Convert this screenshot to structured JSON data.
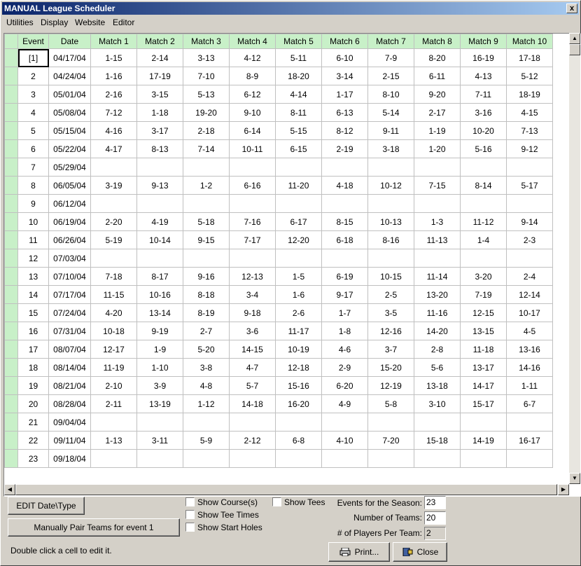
{
  "window": {
    "title": "MANUAL League Scheduler",
    "close_label": "x"
  },
  "menu": [
    "Utilities",
    "Display",
    "Website",
    "Editor"
  ],
  "grid": {
    "headers": [
      "Event",
      "Date",
      "Match 1",
      "Match 2",
      "Match 3",
      "Match 4",
      "Match 5",
      "Match 6",
      "Match 7",
      "Match 8",
      "Match 9",
      "Match 10"
    ],
    "rows": [
      [
        "[1]",
        "04/17/04",
        "1-15",
        "2-14",
        "3-13",
        "4-12",
        "5-11",
        "6-10",
        "7-9",
        "8-20",
        "16-19",
        "17-18"
      ],
      [
        "2",
        "04/24/04",
        "1-16",
        "17-19",
        "7-10",
        "8-9",
        "18-20",
        "3-14",
        "2-15",
        "6-11",
        "4-13",
        "5-12"
      ],
      [
        "3",
        "05/01/04",
        "2-16",
        "3-15",
        "5-13",
        "6-12",
        "4-14",
        "1-17",
        "8-10",
        "9-20",
        "7-11",
        "18-19"
      ],
      [
        "4",
        "05/08/04",
        "7-12",
        "1-18",
        "19-20",
        "9-10",
        "8-11",
        "6-13",
        "5-14",
        "2-17",
        "3-16",
        "4-15"
      ],
      [
        "5",
        "05/15/04",
        "4-16",
        "3-17",
        "2-18",
        "6-14",
        "5-15",
        "8-12",
        "9-11",
        "1-19",
        "10-20",
        "7-13"
      ],
      [
        "6",
        "05/22/04",
        "4-17",
        "8-13",
        "7-14",
        "10-11",
        "6-15",
        "2-19",
        "3-18",
        "1-20",
        "5-16",
        "9-12"
      ],
      [
        "7",
        "05/29/04",
        "",
        "",
        "",
        "",
        "",
        "",
        "",
        "",
        "",
        ""
      ],
      [
        "8",
        "06/05/04",
        "3-19",
        "9-13",
        "1-2",
        "6-16",
        "11-20",
        "4-18",
        "10-12",
        "7-15",
        "8-14",
        "5-17"
      ],
      [
        "9",
        "06/12/04",
        "",
        "",
        "",
        "",
        "",
        "",
        "",
        "",
        "",
        ""
      ],
      [
        "10",
        "06/19/04",
        "2-20",
        "4-19",
        "5-18",
        "7-16",
        "6-17",
        "8-15",
        "10-13",
        "1-3",
        "11-12",
        "9-14"
      ],
      [
        "11",
        "06/26/04",
        "5-19",
        "10-14",
        "9-15",
        "7-17",
        "12-20",
        "6-18",
        "8-16",
        "11-13",
        "1-4",
        "2-3"
      ],
      [
        "12",
        "07/03/04",
        "",
        "",
        "",
        "",
        "",
        "",
        "",
        "",
        "",
        ""
      ],
      [
        "13",
        "07/10/04",
        "7-18",
        "8-17",
        "9-16",
        "12-13",
        "1-5",
        "6-19",
        "10-15",
        "11-14",
        "3-20",
        "2-4"
      ],
      [
        "14",
        "07/17/04",
        "11-15",
        "10-16",
        "8-18",
        "3-4",
        "1-6",
        "9-17",
        "2-5",
        "13-20",
        "7-19",
        "12-14"
      ],
      [
        "15",
        "07/24/04",
        "4-20",
        "13-14",
        "8-19",
        "9-18",
        "2-6",
        "1-7",
        "3-5",
        "11-16",
        "12-15",
        "10-17"
      ],
      [
        "16",
        "07/31/04",
        "10-18",
        "9-19",
        "2-7",
        "3-6",
        "11-17",
        "1-8",
        "12-16",
        "14-20",
        "13-15",
        "4-5"
      ],
      [
        "17",
        "08/07/04",
        "12-17",
        "1-9",
        "5-20",
        "14-15",
        "10-19",
        "4-6",
        "3-7",
        "2-8",
        "11-18",
        "13-16"
      ],
      [
        "18",
        "08/14/04",
        "11-19",
        "1-10",
        "3-8",
        "4-7",
        "12-18",
        "2-9",
        "15-20",
        "5-6",
        "13-17",
        "14-16"
      ],
      [
        "19",
        "08/21/04",
        "2-10",
        "3-9",
        "4-8",
        "5-7",
        "15-16",
        "6-20",
        "12-19",
        "13-18",
        "14-17",
        "1-11"
      ],
      [
        "20",
        "08/28/04",
        "2-11",
        "13-19",
        "1-12",
        "14-18",
        "16-20",
        "4-9",
        "5-8",
        "3-10",
        "15-17",
        "6-7"
      ],
      [
        "21",
        "09/04/04",
        "",
        "",
        "",
        "",
        "",
        "",
        "",
        "",
        "",
        ""
      ],
      [
        "22",
        "09/11/04",
        "1-13",
        "3-11",
        "5-9",
        "2-12",
        "6-8",
        "4-10",
        "7-20",
        "15-18",
        "14-19",
        "16-17"
      ],
      [
        "23",
        "09/18/04",
        "",
        "",
        "",
        "",
        "",
        "",
        "",
        "",
        "",
        ""
      ]
    ]
  },
  "buttons": {
    "edit": "EDIT Date\\Type",
    "pair": "Manually Pair Teams for event 1",
    "print": "Print...",
    "close": "Close"
  },
  "options": {
    "show_courses": "Show Course(s)",
    "show_tee_times": "Show Tee Times",
    "show_start_holes": "Show Start Holes",
    "show_tees": "Show Tees"
  },
  "settings": {
    "events_label": "Events for the Season:",
    "events_value": "23",
    "teams_label": "Number of Teams:",
    "teams_value": "20",
    "players_label": "# of Players Per Team:",
    "players_value": "2"
  },
  "status": "Double click a cell to edit it.",
  "colors": {
    "header_bg": "#c8f0c8",
    "title_start": "#0a246a",
    "title_end": "#a6caf0"
  }
}
